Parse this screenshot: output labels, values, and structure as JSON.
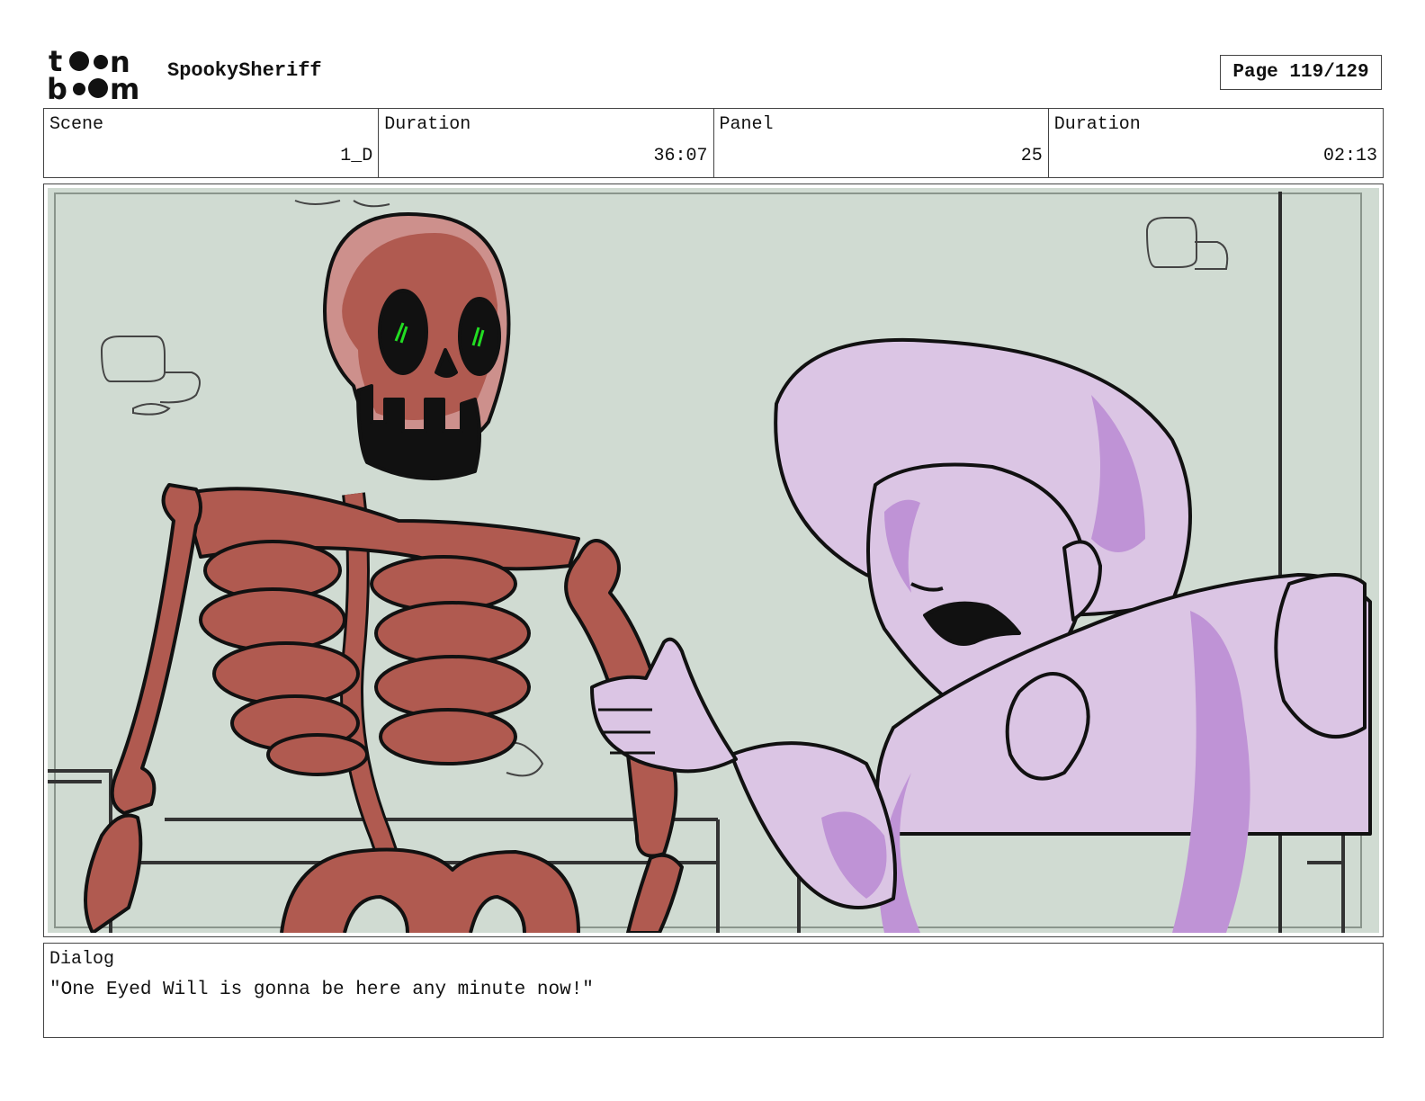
{
  "header": {
    "logo_text_top": "toon",
    "logo_text_bottom": "boom",
    "project_title": "SpookySheriff",
    "page_label": "Page",
    "page_number": "119/129"
  },
  "info": {
    "scene_label": "Scene",
    "scene_value": "1_D",
    "scene_duration_label": "Duration",
    "scene_duration_value": "36:07",
    "panel_label": "Panel",
    "panel_value": "25",
    "panel_duration_label": "Duration",
    "panel_duration_value": "02:13"
  },
  "panel": {
    "background_color": "#d0dbd2",
    "skeleton_color": "#b05a50",
    "skeleton_highlight": "#cd908c",
    "woman_color": "#dbc5e4",
    "woman_shadow": "#bf93d6",
    "eye_glow": "#22dd22"
  },
  "dialog": {
    "label": "Dialog",
    "text": "\"One Eyed Will is gonna be here any minute now!\""
  }
}
